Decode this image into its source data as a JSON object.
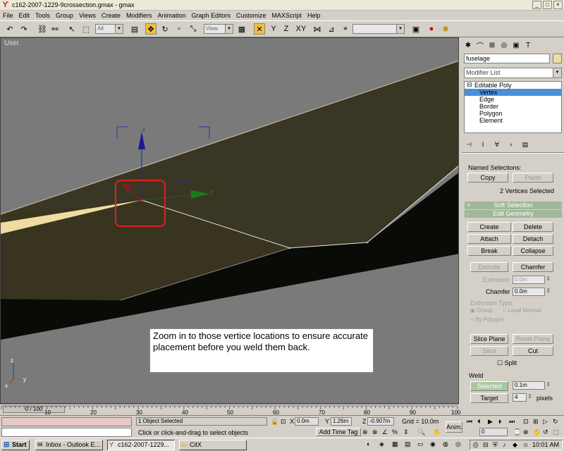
{
  "window": {
    "title": "c162-2007-1229-9crossection.gmax - gmax",
    "min": "_",
    "max": "□",
    "close": "×"
  },
  "menu": [
    "File",
    "Edit",
    "Tools",
    "Group",
    "Views",
    "Create",
    "Modifiers",
    "Animation",
    "Graph Editors",
    "Customize",
    "MAXScript",
    "Help"
  ],
  "toolbar": {
    "selection_filter": "All",
    "ref_coord": "View",
    "named_selection": ""
  },
  "viewport": {
    "label": "User",
    "annotation": "Zoom in to those vertice locations to ensure accurate placement before you weld them back.",
    "gizmo_labels": {
      "z": "z",
      "y": "y"
    },
    "axis_labels": {
      "z": "z",
      "y": "y",
      "x": "x"
    }
  },
  "panel": {
    "object_name": "fuselage",
    "object_color": "#f0dca0",
    "modifier_list": "Modifier List",
    "stack": {
      "base": "Editable Poly",
      "subs": [
        "Vertex",
        "Edge",
        "Border",
        "Polygon",
        "Element"
      ],
      "selected": "Vertex"
    },
    "named_selections": {
      "label": "Named Selections:",
      "copy": "Copy",
      "paste": "Paste"
    },
    "selection_info": "2 Vertices Selected",
    "soft_selection": "Soft Selection",
    "edit_geometry": "Edit Geometry",
    "buttons": {
      "create": "Create",
      "delete": "Delete",
      "attach": "Attach",
      "detach": "Detach",
      "break": "Break",
      "collapse": "Collapse",
      "extrude": "Extrude",
      "chamfer": "Chamfer",
      "slice_plane": "Slice Plane",
      "reset_plane": "Reset Plane",
      "slice": "Slice",
      "cut": "Cut"
    },
    "extrusion": {
      "label": "Extrusion",
      "value": "0.0m"
    },
    "chamfer": {
      "label": "Chamfer",
      "value": "0.0m"
    },
    "extrusion_type": {
      "label": "Extrusion Type",
      "group": "Group",
      "local_normal": "Local Normal",
      "by_polygon": "By Polygon"
    },
    "split": "Split",
    "weld": {
      "label": "Weld",
      "selected": "Selected",
      "selected_value": "0.1m",
      "target": "Target",
      "target_value": "4",
      "pixels": "pixels"
    },
    "sign_plus": "+",
    "sign_minus": "-"
  },
  "timeline": {
    "frame": "0 / 100",
    "ticks": [
      "10",
      "20",
      "30",
      "40",
      "50",
      "60",
      "70",
      "80",
      "90",
      "100"
    ]
  },
  "status": {
    "selection": "1 Object Selected",
    "prompt": "Click or click-and-drag to select objects",
    "x_label": "X",
    "x": "0.0m",
    "y_label": "Y",
    "y": "1.26m",
    "z_label": "Z",
    "z": "-0.907m",
    "grid": "Grid = 10.0m",
    "add_time_tag": "Add Time Tag",
    "anim": "Anim.",
    "frame_field": "0"
  },
  "taskbar": {
    "start": "Start",
    "tasks": [
      "Inbox - Outlook E...",
      "c162-2007-1229...",
      "CitX"
    ],
    "clock": "10:01 AM"
  }
}
